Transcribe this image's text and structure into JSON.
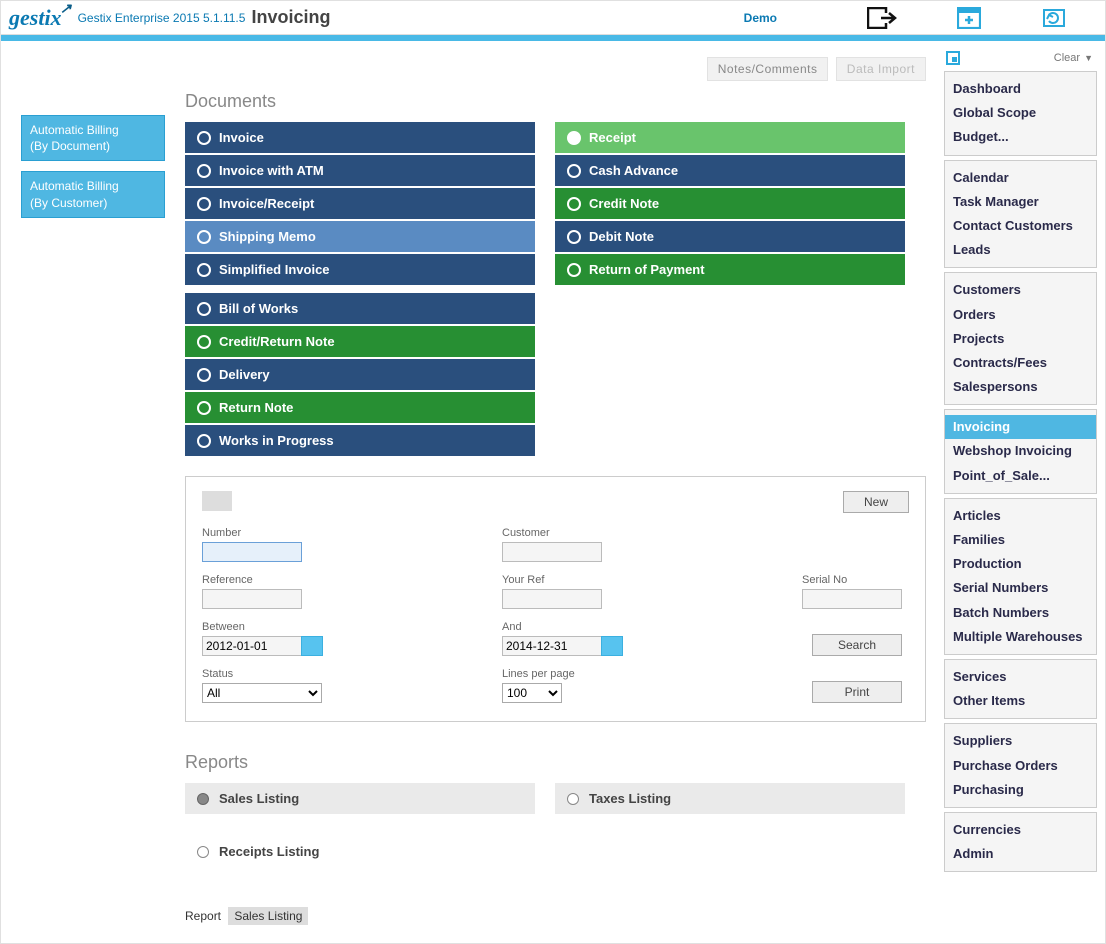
{
  "header": {
    "logo_text": "gestix",
    "app_version": "Gestix Enterprise 2015 5.1.11.5",
    "page_title": "Invoicing",
    "demo_link": "Demo"
  },
  "left_sidebar": {
    "btn1_line1": "Automatic Billing",
    "btn1_line2": "(By Document)",
    "btn2_line1": "Automatic Billing",
    "btn2_line2": "(By Customer)"
  },
  "toolbar": {
    "notes_tab": "Notes/Comments",
    "data_import_tab": "Data Import"
  },
  "sections": {
    "documents_title": "Documents",
    "reports_title": "Reports"
  },
  "documents_left": [
    {
      "label": "Invoice",
      "color": "c-darkblue"
    },
    {
      "label": "Invoice with ATM",
      "color": "c-darkblue"
    },
    {
      "label": "Invoice/Receipt",
      "color": "c-darkblue"
    },
    {
      "label": "Shipping Memo",
      "color": "c-lightblue"
    },
    {
      "label": "Simplified Invoice",
      "color": "c-darkblue"
    }
  ],
  "documents_left2": [
    {
      "label": "Bill of Works",
      "color": "c-darkblue"
    },
    {
      "label": "Credit/Return Note",
      "color": "c-green"
    },
    {
      "label": "Delivery",
      "color": "c-darkblue"
    },
    {
      "label": "Return Note",
      "color": "c-green"
    },
    {
      "label": "Works in Progress",
      "color": "c-darkblue"
    }
  ],
  "documents_right": [
    {
      "label": "Receipt",
      "color": "c-brightgreen",
      "selected": true
    },
    {
      "label": "Cash Advance",
      "color": "c-darkblue"
    },
    {
      "label": "Credit Note",
      "color": "c-green"
    },
    {
      "label": "Debit Note",
      "color": "c-darkblue"
    },
    {
      "label": "Return of Payment",
      "color": "c-green"
    }
  ],
  "search": {
    "new_btn": "New",
    "number_label": "Number",
    "number_value": "",
    "customer_label": "Customer",
    "customer_value": "",
    "reference_label": "Reference",
    "reference_value": "",
    "your_ref_label": "Your Ref",
    "your_ref_value": "",
    "serial_label": "Serial No",
    "serial_value": "",
    "between_label": "Between",
    "between_value": "2012-01-01",
    "and_label": "And",
    "and_value": "2014-12-31",
    "status_label": "Status",
    "status_value": "All",
    "lpp_label": "Lines per page",
    "lpp_value": "100",
    "search_btn": "Search",
    "print_btn": "Print"
  },
  "reports": {
    "sales_listing": "Sales Listing",
    "taxes_listing": "Taxes Listing",
    "receipts_listing": "Receipts Listing",
    "footer_label": "Report",
    "footer_value": "Sales Listing"
  },
  "right_sidebar": {
    "clear_label": "Clear",
    "group1": [
      "Dashboard",
      "Global Scope",
      "Budget..."
    ],
    "group2": [
      "Calendar",
      "Task Manager",
      "Contact Customers",
      "Leads"
    ],
    "group3": [
      "Customers",
      "Orders",
      "Projects",
      "Contracts/Fees",
      "Salespersons"
    ],
    "group4": [
      "Invoicing",
      "Webshop Invoicing",
      "Point_of_Sale..."
    ],
    "group5": [
      "Articles",
      "Families",
      "Production",
      "Serial Numbers",
      "Batch Numbers",
      "Multiple Warehouses"
    ],
    "group6": [
      "Services",
      "Other Items"
    ],
    "group7": [
      "Suppliers",
      "Purchase Orders",
      "Purchasing"
    ],
    "group8": [
      "Currencies",
      "Admin"
    ],
    "active": "Invoicing"
  }
}
